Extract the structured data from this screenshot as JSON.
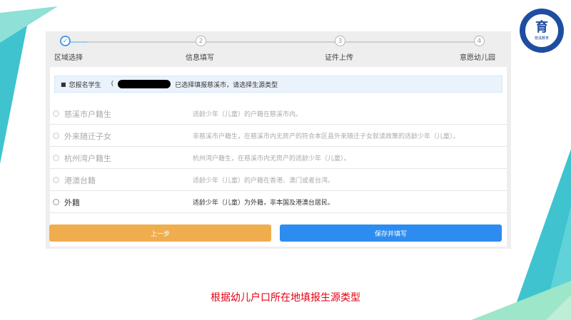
{
  "colors": {
    "accent": "#2d8cf0",
    "prev_button": "#f0ad4e",
    "caption": "#e60012",
    "logo": "#1f4ea1"
  },
  "logo": {
    "glyph": "育",
    "sub": "慈溪教育"
  },
  "steps": [
    {
      "num": "✓",
      "label": "区域选择",
      "active": true
    },
    {
      "num": "2",
      "label": "信息填写",
      "active": false
    },
    {
      "num": "3",
      "label": "证件上传",
      "active": false
    },
    {
      "num": "4",
      "label": "意愿幼儿园",
      "active": false
    }
  ],
  "notice": {
    "bullet": "■",
    "prefix": "您报名学生",
    "paren": "(",
    "suffix": "已选择填报慈溪市，请选择生源类型"
  },
  "options": [
    {
      "label": "慈溪市户籍生",
      "desc": "适龄少年（儿童）的户籍在慈溪市内。",
      "enabled": false
    },
    {
      "label": "外来随迁子女",
      "desc": "非慈溪市户籍生，在慈溪市内无房产的符合本区县外来随迁子女就读政策的适龄少年（儿童）。",
      "enabled": false
    },
    {
      "label": "杭州湾户籍生",
      "desc": "杭州湾户籍生，在慈溪市内无房产的适龄少年（儿童）。",
      "enabled": false
    },
    {
      "label": "港澳台籍",
      "desc": "适龄少年（儿童）的户籍在香港、澳门或者台湾。",
      "enabled": false
    },
    {
      "label": "外籍",
      "desc": "适龄少年（儿童）为外籍，非本国及港澳台居民。",
      "enabled": true
    }
  ],
  "buttons": {
    "prev": "上一步",
    "save": "保存并填写"
  },
  "caption": "根据幼儿户口所在地填报生源类型"
}
